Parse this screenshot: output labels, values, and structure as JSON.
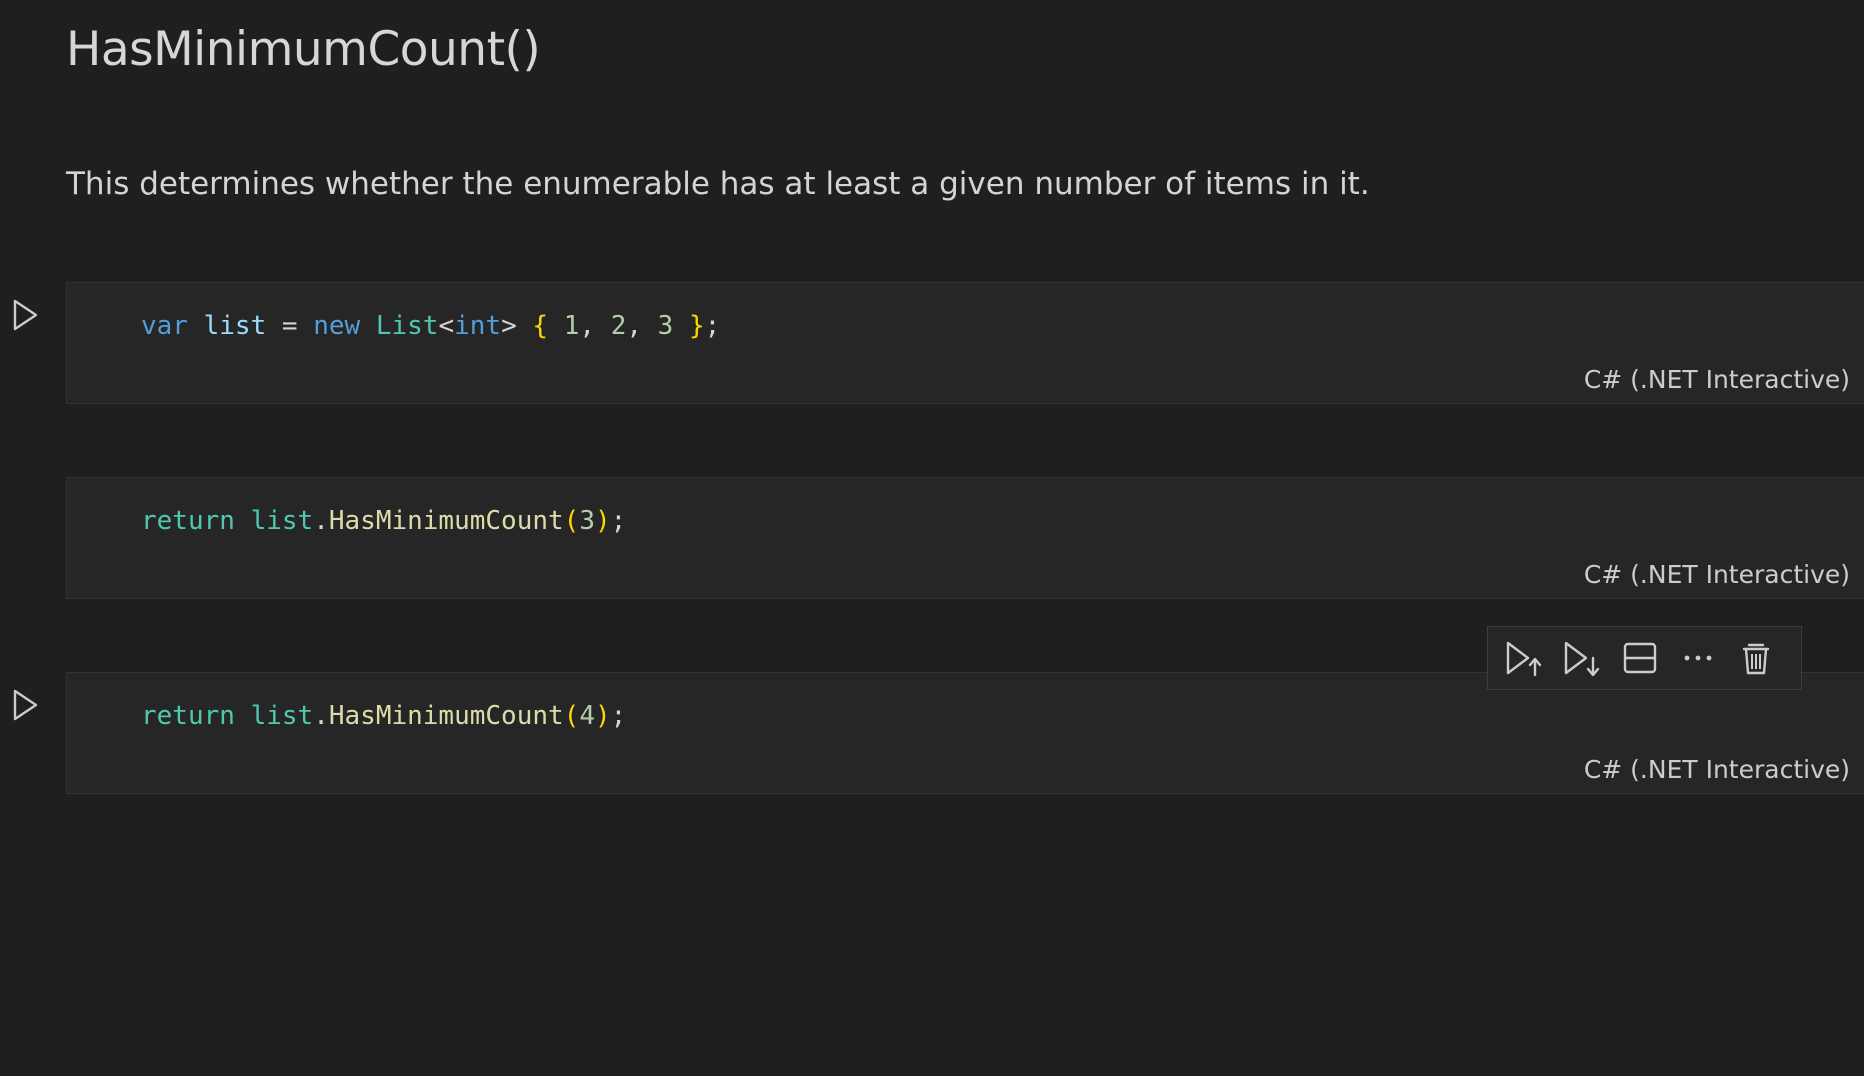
{
  "heading": "HasMinimumCount()",
  "description": "This determines whether the enumerable has at least a given number of items in it.",
  "cells": [
    {
      "language": "C# (.NET Interactive)",
      "tokens": {
        "t1": "var",
        "t2": "list",
        "t3": "=",
        "t4": "new",
        "t5": "List",
        "t6": "<",
        "t7": "int",
        "t8": ">",
        "t9": "{",
        "t10": "1",
        "t11": ",",
        "t12": "2",
        "t13": ",",
        "t14": "3",
        "t15": "}",
        "t16": ";"
      }
    },
    {
      "language": "C# (.NET Interactive)",
      "tokens": {
        "t1": "return",
        "t2": "list",
        "t3": ".",
        "t4": "HasMinimumCount",
        "t5": "(",
        "t6": "3",
        "t7": ")",
        "t8": ";"
      }
    },
    {
      "language": "C# (.NET Interactive)",
      "tokens": {
        "t1": "return",
        "t2": "list",
        "t3": ".",
        "t4": "HasMinimumCount",
        "t5": "(",
        "t6": "4",
        "t7": ")",
        "t8": ";"
      }
    }
  ],
  "toolbar": {
    "icons": [
      "execute-above-icon",
      "execute-below-icon",
      "split-cell-icon",
      "more-actions-icon",
      "delete-icon"
    ]
  },
  "colors": {
    "background": "#1f1f1f",
    "cell_background": "#262626",
    "keyword": "#569cd6",
    "type": "#4ec9b0",
    "method": "#dcdcaa",
    "bracket": "#ffd700",
    "variable": "#9cdcfe"
  }
}
